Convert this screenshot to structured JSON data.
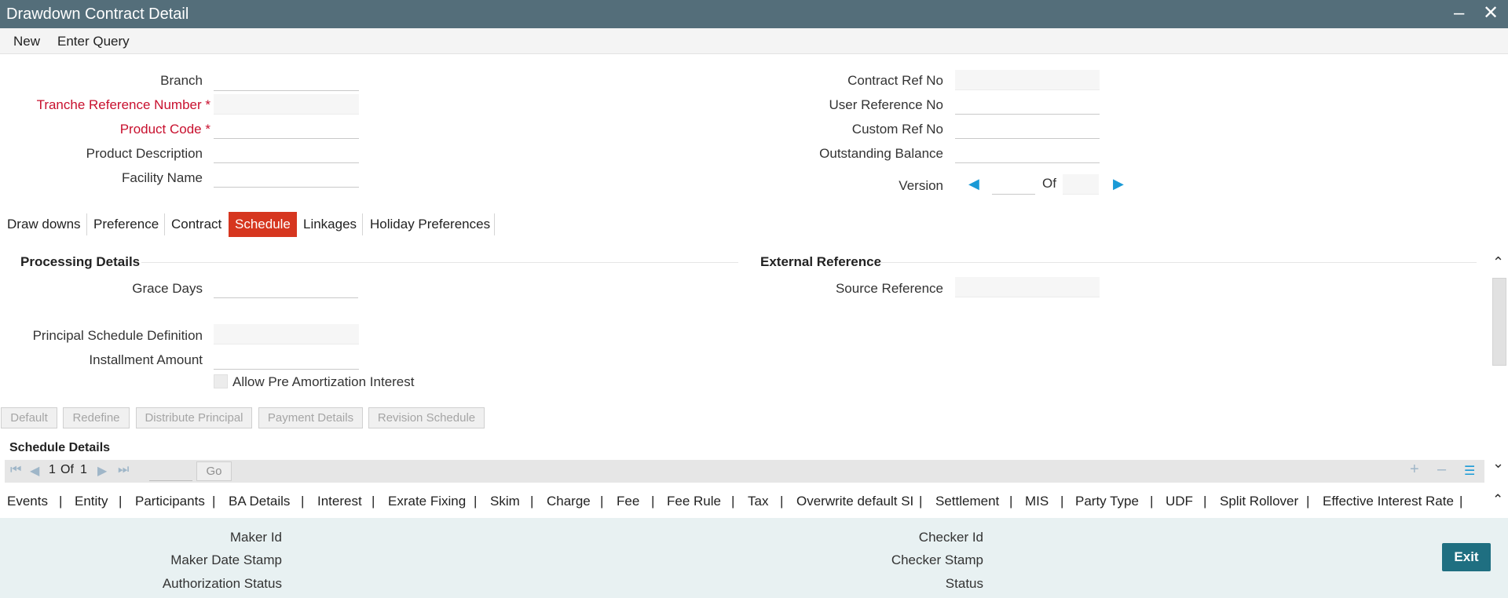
{
  "window": {
    "title": "Drawdown Contract Detail",
    "minimize_icon": "minimize-icon",
    "close_icon": "close-icon"
  },
  "menu": {
    "new": "New",
    "enter_query": "Enter Query"
  },
  "header": {
    "branch": {
      "label": "Branch",
      "value": ""
    },
    "tranche_ref": {
      "label": "Tranche Reference Number",
      "required": "*",
      "value": ""
    },
    "product_code": {
      "label": "Product Code",
      "required": "*",
      "value": ""
    },
    "product_description": {
      "label": "Product Description",
      "value": ""
    },
    "facility_name": {
      "label": "Facility Name",
      "value": ""
    },
    "contract_ref": {
      "label": "Contract Ref No",
      "value": ""
    },
    "user_ref": {
      "label": "User Reference No",
      "value": ""
    },
    "custom_ref": {
      "label": "Custom Ref No",
      "value": ""
    },
    "outstanding_balance": {
      "label": "Outstanding Balance",
      "value": ""
    },
    "version": {
      "label": "Version",
      "of": "Of",
      "value": "",
      "total": ""
    }
  },
  "tabs": [
    "Draw downs",
    "Preference",
    "Contract",
    "Schedule",
    "Linkages",
    "Holiday Preferences"
  ],
  "active_tab": "Schedule",
  "processing": {
    "title": "Processing Details",
    "grace_days": {
      "label": "Grace Days",
      "value": ""
    },
    "principal_schedule": {
      "label": "Principal Schedule Definition",
      "value": ""
    },
    "installment_amount": {
      "label": "Installment Amount",
      "value": ""
    },
    "allow_pre_amortization": {
      "label": "Allow Pre Amortization Interest",
      "checked": false
    }
  },
  "external": {
    "title": "External Reference",
    "source_reference": {
      "label": "Source Reference",
      "value": ""
    }
  },
  "schedule_buttons": [
    "Default",
    "Redefine",
    "Distribute Principal",
    "Payment Details",
    "Revision Schedule"
  ],
  "schedule_details": {
    "title": "Schedule Details",
    "pager": {
      "current": "1",
      "of": "Of",
      "total": "1",
      "go": "Go"
    }
  },
  "bottom_links": [
    "Events",
    "Entity",
    "Participants",
    "BA Details",
    "Interest",
    "Exrate Fixing",
    "Skim",
    "Charge",
    "Fee",
    "Fee Rule",
    "Tax",
    "Overwrite default SI",
    "Settlement",
    "MIS",
    "Party Type",
    "UDF",
    "Split Rollover",
    "Effective Interest Rate"
  ],
  "audit": {
    "maker_id": "Maker Id",
    "maker_date_stamp": "Maker Date Stamp",
    "authorization_status": "Authorization Status",
    "checker_id": "Checker Id",
    "checker_stamp": "Checker Stamp",
    "status": "Status"
  },
  "exit_label": "Exit",
  "colors": {
    "titlebar": "#546e7a",
    "active_tab": "#d6361f",
    "required_label": "#c8102e",
    "exit_button": "#1f6f81",
    "footer_bg": "#e8f1f2"
  }
}
